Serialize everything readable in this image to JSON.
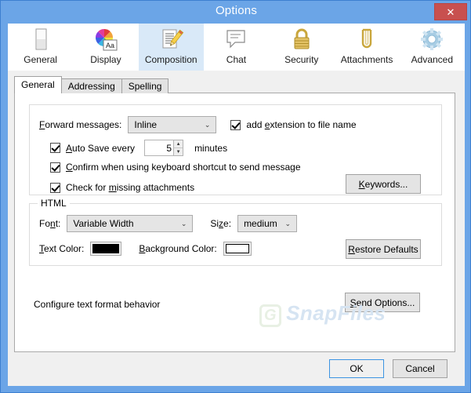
{
  "window": {
    "title": "Options",
    "close_label": "✕"
  },
  "toolbar": {
    "items": [
      {
        "label": "General",
        "icon": "document-page-icon",
        "active": false
      },
      {
        "label": "Display",
        "icon": "color-wheel-aa-icon",
        "active": false
      },
      {
        "label": "Composition",
        "icon": "document-pencil-icon",
        "active": true
      },
      {
        "label": "Chat",
        "icon": "speech-bubble-icon",
        "active": false
      },
      {
        "label": "Security",
        "icon": "padlock-icon",
        "active": false
      },
      {
        "label": "Attachments",
        "icon": "paperclip-icon",
        "active": false
      },
      {
        "label": "Advanced",
        "icon": "gear-icon",
        "active": false
      }
    ]
  },
  "tabs": [
    {
      "label": "General",
      "active": true
    },
    {
      "label": "Addressing",
      "active": false
    },
    {
      "label": "Spelling",
      "active": false
    }
  ],
  "general_panel": {
    "forward_messages": {
      "label_pre": "F",
      "label_post": "orward messages:",
      "value": "Inline",
      "arrow": "⌄"
    },
    "add_extension": {
      "checked": true,
      "text_pre": "add ",
      "accel": "e",
      "text_post": "xtension to file name"
    },
    "auto_save": {
      "checked": true,
      "accel": "A",
      "text_pre": "",
      "text_post": "uto Save every",
      "value": "5",
      "units": "minutes",
      "spin_up": "▲",
      "spin_down": "▼"
    },
    "confirm_shortcut": {
      "checked": true,
      "accel": "C",
      "text_post": "onfirm when using keyboard shortcut to send message"
    },
    "check_missing": {
      "checked": true,
      "text_pre": "Check for ",
      "accel": "m",
      "text_post": "issing attachments"
    },
    "keywords_button": {
      "accel": "K",
      "text_post": "eywords..."
    }
  },
  "html_panel": {
    "group_label": "HTML",
    "font": {
      "label_pre": "Fo",
      "accel": "n",
      "label_post": "t:",
      "value": "Variable Width",
      "arrow": "⌄"
    },
    "size": {
      "label_pre": "Si",
      "accel": "z",
      "label_post": "e:",
      "value": "medium",
      "arrow": "⌄"
    },
    "text_color": {
      "accel": "T",
      "label_post": "ext Color:",
      "color": "#000000"
    },
    "background_color": {
      "accel": "B",
      "label_post": "ackground Color:",
      "color": "#ffffff"
    },
    "restore_defaults": {
      "accel": "R",
      "text_post": "estore Defaults"
    }
  },
  "footer_area": {
    "configure_text": "Configure text format behavior",
    "send_options": {
      "accel": "S",
      "text_post": "end Options..."
    }
  },
  "watermark": {
    "mark": "G",
    "text": "SnapFiles"
  },
  "dialog_buttons": {
    "ok": "OK",
    "cancel": "Cancel"
  },
  "colors": {
    "titlebar": "#6ba5e7",
    "close_button": "#c8504f",
    "active_tool": "#d9e9f8",
    "accent_focus": "#3c94e2"
  }
}
